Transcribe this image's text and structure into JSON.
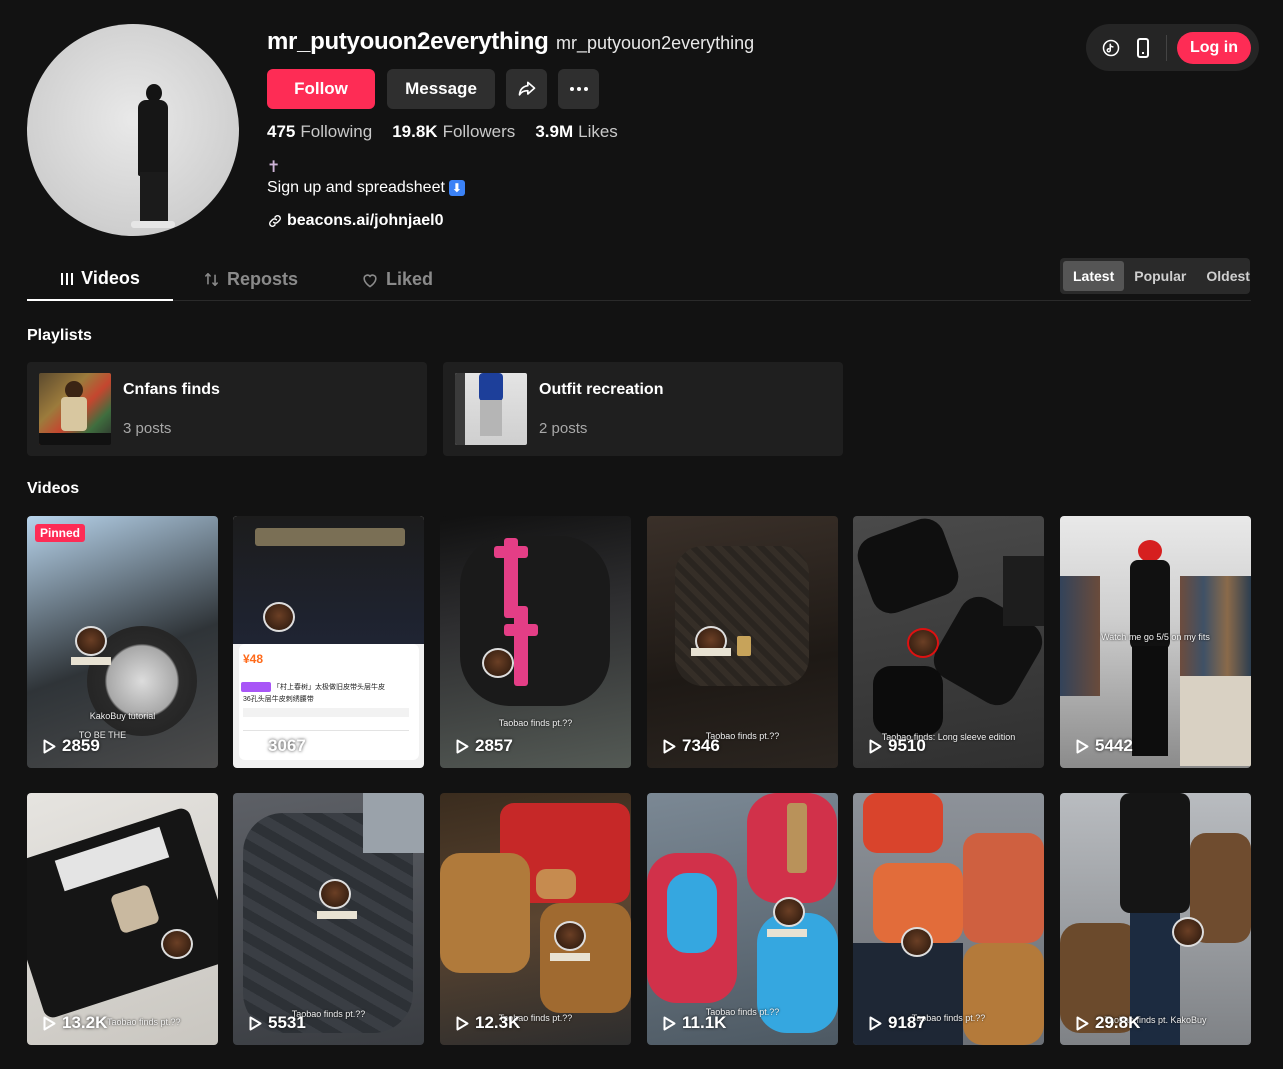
{
  "profile": {
    "username": "mr_putyouon2everything",
    "nickname": "mr_putyouon2everything",
    "follow_label": "Follow",
    "message_label": "Message",
    "stats": {
      "following_num": "475",
      "following_label": "Following",
      "followers_num": "19.8K",
      "followers_label": "Followers",
      "likes_num": "3.9M",
      "likes_label": "Likes"
    },
    "bio_line1": "✝",
    "bio_line2": "Sign up and spreadsheet",
    "bio_arrow": "⬇",
    "link": "beacons.ai/johnjael0"
  },
  "topbar": {
    "login_label": "Log in"
  },
  "tabs": [
    {
      "label": "Videos",
      "icon": "grid-icon"
    },
    {
      "label": "Reposts",
      "icon": "repost-icon"
    },
    {
      "label": "Liked",
      "icon": "liked-heart-icon"
    }
  ],
  "sort": {
    "options": [
      "Latest",
      "Popular",
      "Oldest"
    ],
    "selected": "Latest"
  },
  "playlists_title": "Playlists",
  "playlists": [
    {
      "name": "Cnfans finds",
      "count": "3 posts"
    },
    {
      "name": "Outfit recreation",
      "count": "2 posts"
    }
  ],
  "videos_title": "Videos",
  "pinned_label": "Pinned",
  "videos": [
    {
      "views": "2859",
      "caption": "KakoBuy tutorial",
      "caption2": "TO BE THE",
      "bg": "#3a3f44"
    },
    {
      "views": "3067",
      "caption": "",
      "bg": "#e8e8e8",
      "price": "¥48",
      "cn_text": "「村上春树」太极做旧皮带头层牛皮",
      "cn_text2": "36孔头层牛皮刺绣腰带"
    },
    {
      "views": "2857",
      "caption": "Taobao finds pt.??",
      "bg": "#2a2a2c"
    },
    {
      "views": "7346",
      "caption": "Taobao finds pt.??",
      "bg": "#2e2621"
    },
    {
      "views": "9510",
      "caption": "Taobao finds: Long sleeve edition",
      "bg": "#343434"
    },
    {
      "views": "5442",
      "caption": "Watch me go 5/5 on my fits",
      "bg": "#a9a9a9"
    },
    {
      "views": "13.2K",
      "caption": "Taobao finds pt.??",
      "bg": "#d2d0cc"
    },
    {
      "views": "5531",
      "caption": "Taobao finds pt.??",
      "bg": "#4a4d52"
    },
    {
      "views": "12.3K",
      "caption": "Taobao finds pt.??",
      "bg": "#7a5a3a"
    },
    {
      "views": "11.1K",
      "caption": "Taobao finds pt.??",
      "bg": "#5d6a76"
    },
    {
      "views": "9187",
      "caption": "Taobao finds pt.??",
      "bg": "#7b7f85"
    },
    {
      "views": "29.8K",
      "caption": "Taobao finds pt. KakoBuy",
      "bg": "#8f8f8f"
    }
  ],
  "colors": {
    "accent": "#fe2c55",
    "background": "#121212",
    "card": "#1f1f1f"
  }
}
